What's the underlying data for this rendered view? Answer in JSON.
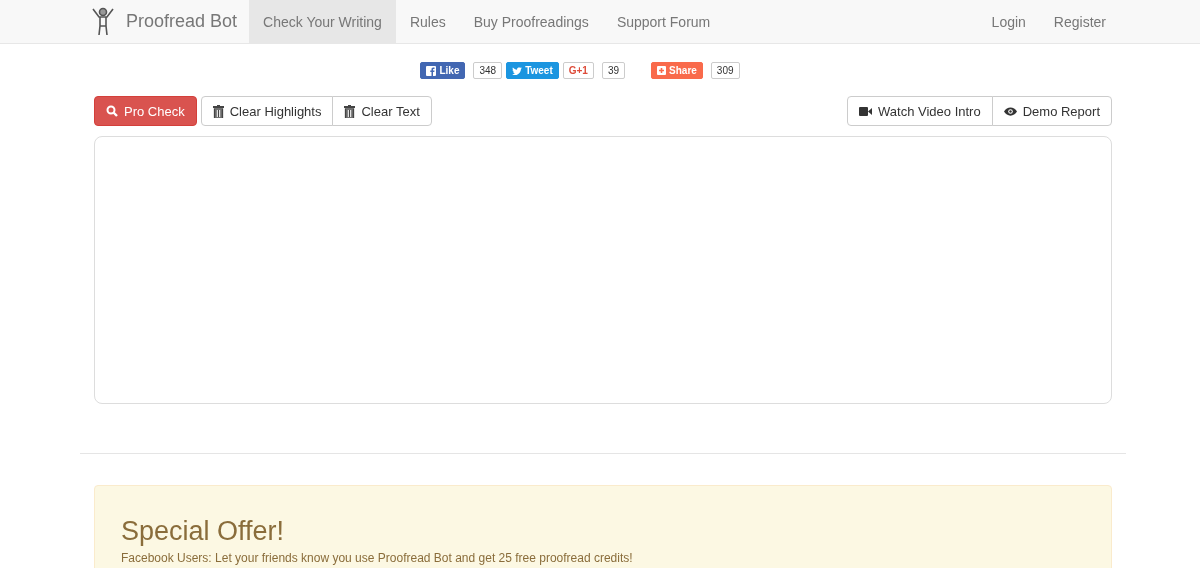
{
  "navbar": {
    "brand": "Proofread Bot",
    "items": [
      {
        "label": "Check Your Writing",
        "selected": true
      },
      {
        "label": "Rules",
        "selected": false
      },
      {
        "label": "Buy Proofreadings",
        "selected": false
      },
      {
        "label": "Support Forum",
        "selected": false
      }
    ],
    "account": [
      "Login",
      "Register"
    ]
  },
  "social": [
    {
      "kind": "facebook",
      "label": "Like",
      "count": "348"
    },
    {
      "kind": "twitter",
      "label": "Tweet"
    },
    {
      "kind": "gplus",
      "label": "G+1",
      "count": "39"
    },
    {
      "kind": "share",
      "label": "Share",
      "count": "309"
    }
  ],
  "toolbar_left": [
    {
      "kind": "search",
      "label": "Pro Check",
      "primary": true
    },
    {
      "kind": "trash",
      "label": "Clear Highlights",
      "primary": false
    },
    {
      "kind": "trash",
      "label": "Clear Text",
      "primary": false
    }
  ],
  "toolbar_right": [
    {
      "kind": "video",
      "label": "Watch Video Intro"
    },
    {
      "kind": "eye",
      "label": "Demo Report"
    }
  ],
  "offer": {
    "title": "Special Offer!",
    "text": "Facebook Users: Let your friends know you use Proofread Bot and get 25 free proofread credits!"
  }
}
